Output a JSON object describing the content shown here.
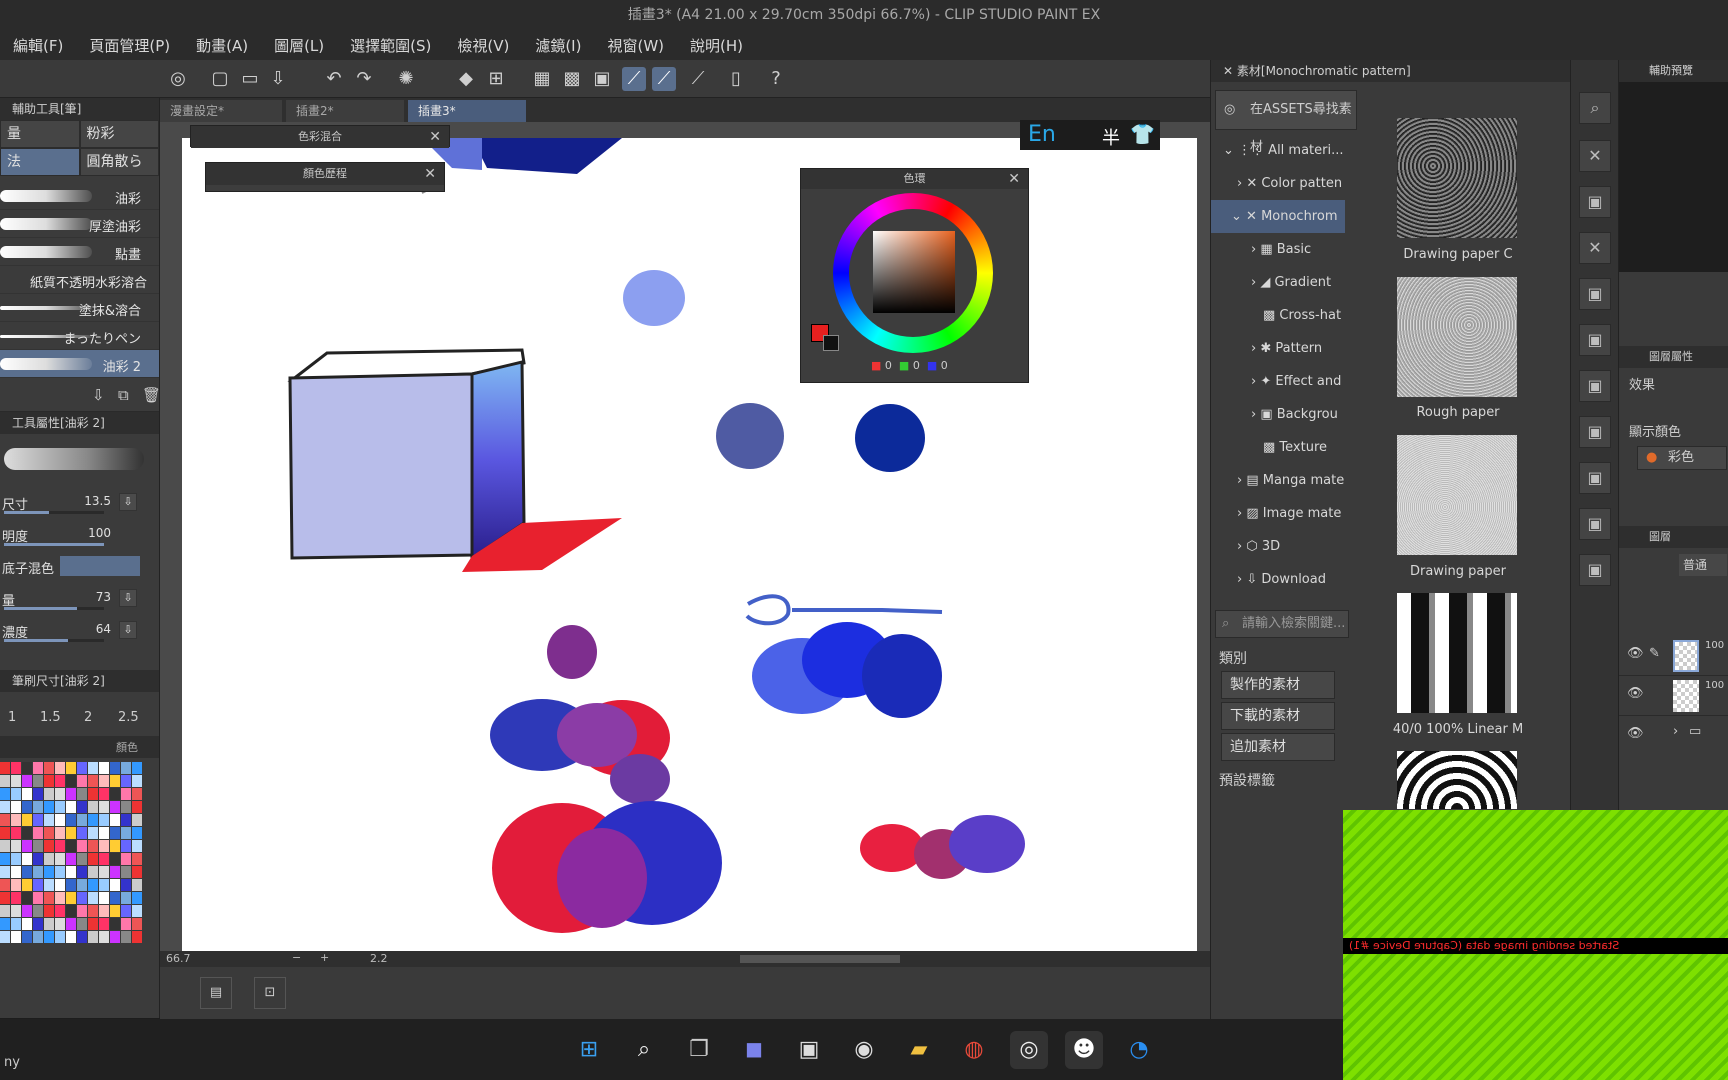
{
  "window": {
    "title": "插畫3* (A4 21.00 x 29.70cm 350dpi 66.7%) - CLIP STUDIO PAINT EX"
  },
  "menu": [
    "編輯(F)",
    "頁面管理(P)",
    "動畫(A)",
    "圖層(L)",
    "選擇範圍(S)",
    "檢視(V)",
    "濾鏡(I)",
    "視窗(W)",
    "說明(H)"
  ],
  "left_panel": {
    "subtool_header": "輔助工具[筆]",
    "subtool_tabs": [
      "量",
      "粉彩",
      "法",
      "圓角散ら"
    ],
    "brushes": [
      "油彩",
      "厚塗油彩",
      "點畫",
      "紙質不透明水彩溶合",
      "塗抹&溶合",
      "まったりペン",
      "油彩 2"
    ],
    "tool_property_header": "工具屬性[油彩 2]",
    "properties": [
      {
        "label": "尺寸",
        "value": "13.5",
        "level": 0.45
      },
      {
        "label": "明度",
        "value": "100",
        "level": 1.0
      },
      {
        "label": "底子混色",
        "value": "",
        "level": 0
      },
      {
        "label": "量",
        "value": "73",
        "level": 0.73
      },
      {
        "label": "濃度",
        "value": "64",
        "level": 0.64
      }
    ],
    "brush_size_header": "筆刷尺寸[油彩 2]",
    "brush_sizes": [
      "1",
      "1.5",
      "2",
      "2.5"
    ],
    "palette_tab_label": "顏色"
  },
  "doc_tabs": [
    "漫畫設定*",
    "插畫2*",
    "插畫3*"
  ],
  "floating": {
    "mix_panel_title": "色彩混合",
    "history_panel_title": "顏色歷程",
    "color_wheel_title": "色環",
    "rgb_values": [
      "0",
      "0",
      "0"
    ],
    "ime_indicator": "En",
    "ime_mode": "半"
  },
  "status": {
    "zoom": "66.7",
    "angle": "2.2"
  },
  "material_panel": {
    "title": "素材[Monochromatic pattern]",
    "assets_button": "在ASSETS尋找素材",
    "tree": [
      "All materi...",
      "Color patten",
      "Monochrom",
      "Basic",
      "Gradient",
      "Cross-hat",
      "Pattern",
      "Effect and",
      "Backgrou",
      "Texture",
      "Manga mate",
      "Image mate",
      "3D",
      "Download"
    ],
    "search_placeholder": "請輸入檢索關鍵...",
    "category_label": "類別",
    "category_buttons": [
      "製作的素材",
      "下載的素材",
      "追加素材"
    ],
    "preset_label": "預設標籤",
    "thumbnails": [
      "Drawing paper C",
      "Rough paper",
      "Drawing paper",
      "40/0 100% Linear M"
    ]
  },
  "right_panel": {
    "nav_title": "輔助預覽",
    "layer_prop_title": "圖層屬性",
    "effect_label": "效果",
    "display_color_label": "顯示顏色",
    "color_mode": "彩色",
    "layer_title": "圖層",
    "blend_mode": "普通",
    "layer_opacity": [
      "100",
      "100"
    ]
  },
  "capture_overlay": {
    "message": "Started sending image data (Capture Device #1)"
  },
  "taskbar": {
    "left_text": "ny",
    "apps": [
      "start",
      "search",
      "task-view",
      "teams",
      "store",
      "alienware",
      "explorer",
      "chrome",
      "clip-studio",
      "qq",
      "qq-browser"
    ]
  },
  "colors": {
    "accent": "#5a6f8e",
    "main_color": "#e8201f",
    "sub_color": "#111111"
  }
}
